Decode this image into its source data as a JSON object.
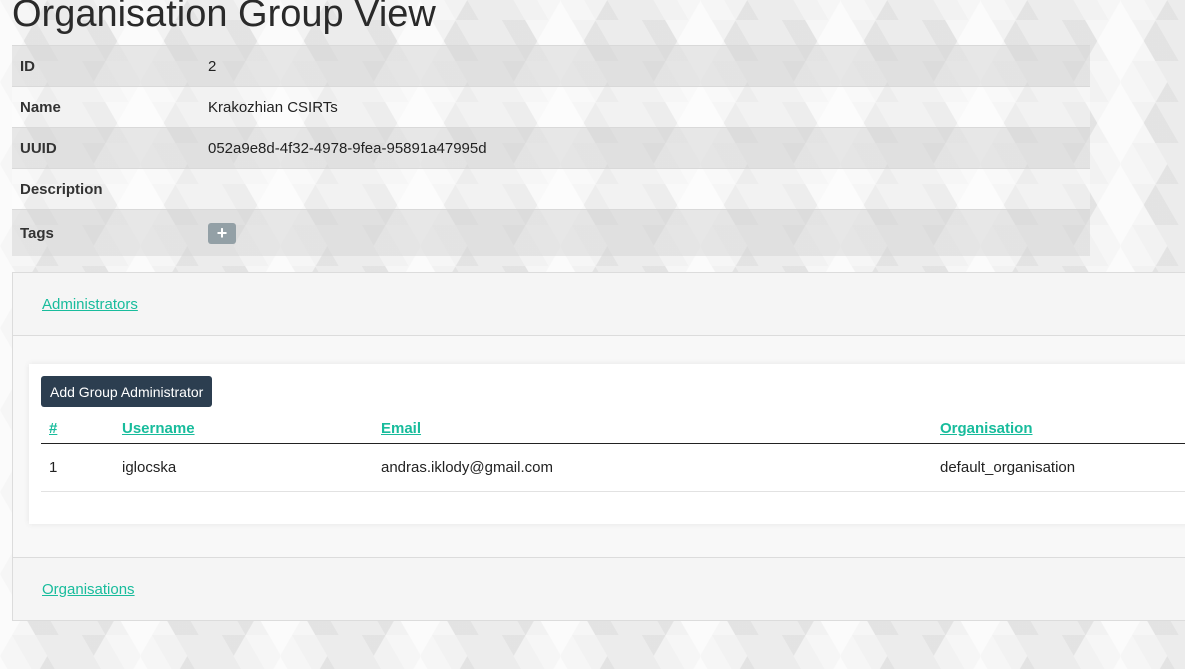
{
  "page": {
    "title": "Organisation Group View"
  },
  "details": {
    "id_label": "ID",
    "id_value": "2",
    "name_label": "Name",
    "name_value": "Krakozhian CSIRTs",
    "uuid_label": "UUID",
    "uuid_value": "052a9e8d-4f32-4978-9fea-95891a47995d",
    "description_label": "Description",
    "description_value": "",
    "tags_label": "Tags",
    "tags_add": "+"
  },
  "administrators": {
    "title": "Administrators",
    "add_button": "Add Group Administrator",
    "columns": [
      "#",
      "Username",
      "Email",
      "Organisation"
    ],
    "rows": [
      {
        "num": "1",
        "username": "iglocska",
        "email": "andras.iklody@gmail.com",
        "organisation": "default_organisation"
      }
    ]
  },
  "organisations": {
    "title": "Organisations"
  },
  "colors": {
    "link": "#18bc9c",
    "button": "#2c3e50",
    "tag_button": "#93a0a6"
  }
}
